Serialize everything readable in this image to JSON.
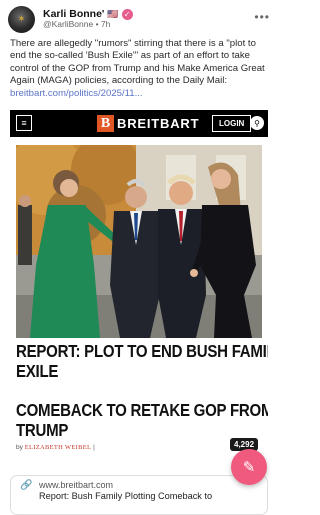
{
  "post": {
    "author_name": "Karli Bonne'",
    "handle_time": "@KarliBonne • 7h",
    "text": "There are allegedly \"rumors\" stirring that there is a \"plot to end the so-called 'Bush Exile'\" as part of an effort to take control of the GOP from Trump and his Make America Great Again (MAGA) policies, according to the Daily Mail: ",
    "link_text": "breitbart.com/politics/2025/11...",
    "more": "•••"
  },
  "embed": {
    "logo_mark": "B",
    "logo_text": "BREITBART",
    "login_label": "LOGIN",
    "menu_glyph": "≡",
    "search_glyph": "⚲",
    "headline_line1": "REPORT: PLOT TO END BUSH FAMILY",
    "headline_line2": "EXILE",
    "headline_line3": "COMEBACK TO RETAKE GOP FROM",
    "headline_line4": "TRUMP",
    "byline_prefix": "by",
    "byline_name": "ELIZABETH WEIBEL",
    "byline_sep": "|"
  },
  "reaction_count": "4,292",
  "link_card": {
    "domain": "www.breitbart.com",
    "title": "Report: Bush Family Plotting Comeback to"
  },
  "icons": {
    "verified": "verified-icon",
    "flag": "us-flag-icon",
    "compose": "compose-icon",
    "link": "link-icon"
  }
}
